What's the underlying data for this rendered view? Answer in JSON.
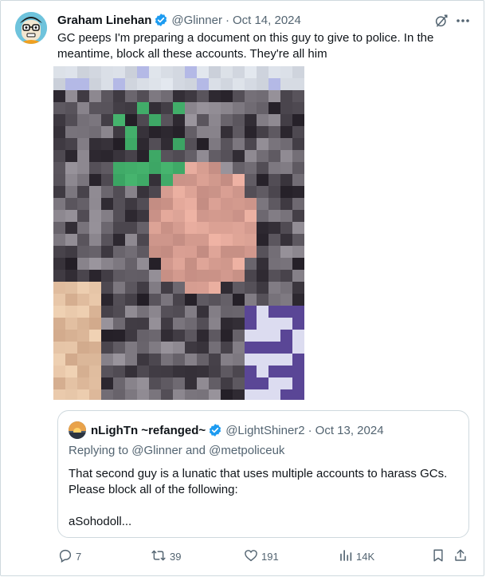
{
  "tweet": {
    "author_name": "Graham Linehan",
    "handle": "@Glinner",
    "separator": "·",
    "date": "Oct 14, 2024",
    "text": "GC peeps I'm preparing a document on this guy to give to police. In the meantime, block all these accounts. They're all him",
    "icons": [
      "verified-badge-icon",
      "grok-icon",
      "more-icon"
    ]
  },
  "quote": {
    "author_name": "nLighTn ~refanged~",
    "handle": "@LightShiner2",
    "separator": "·",
    "date": "Oct 13, 2024",
    "replying_to": "Replying to @Glinner and @metpoliceuk",
    "text": "That second guy is a lunatic that uses multiple accounts to harass GCs. Please block all of the following:\n\naSohodoll..."
  },
  "actions": {
    "replies": "7",
    "reposts": "39",
    "likes": "191",
    "views": "14K"
  },
  "colors": {
    "text": "#0f1419",
    "secondary": "#536471",
    "verified": "#1d9bf0",
    "border": "#cfd9de"
  }
}
